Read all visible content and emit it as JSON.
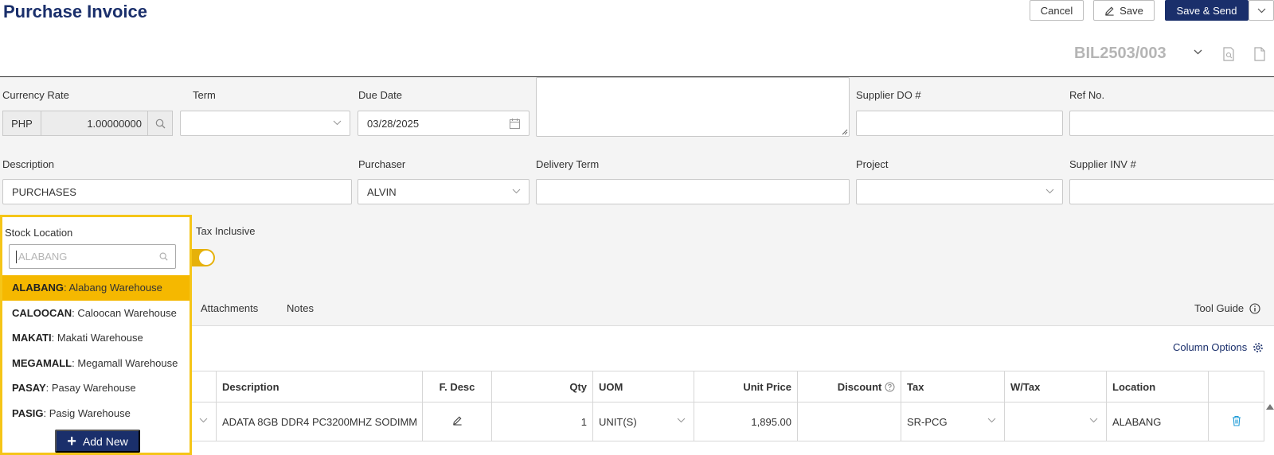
{
  "header": {
    "title": "Purchase Invoice",
    "cancel_label": "Cancel",
    "save_label": "Save",
    "save_send_label": "Save & Send",
    "doc_no": "BIL2503/003"
  },
  "form": {
    "currency_rate_label": "Currency Rate",
    "currency_code": "PHP",
    "currency_rate": "1.00000000",
    "term_label": "Term",
    "term_value": "",
    "due_date_label": "Due Date",
    "due_date_value": "03/28/2025",
    "supplier_do_label": "Supplier DO #",
    "ref_no_label": "Ref No.",
    "description_label": "Description",
    "description_value": "PURCHASES",
    "purchaser_label": "Purchaser",
    "purchaser_value": "ALVIN",
    "delivery_term_label": "Delivery Term",
    "project_label": "Project",
    "supplier_inv_label": "Supplier INV #",
    "stock_location_label": "Stock Location",
    "tax_inclusive_label": "Tax Inclusive",
    "tax_inclusive_on": true
  },
  "tabs": [
    "Attachments",
    "Notes"
  ],
  "tool_guide_label": "Tool Guide",
  "column_options_label": "Column Options",
  "grid": {
    "columns": [
      "Description",
      "F. Desc",
      "Qty",
      "UOM",
      "Unit Price",
      "Discount",
      "Tax",
      "W/Tax",
      "Location"
    ],
    "rows": [
      {
        "description": "ADATA 8GB DDR4 PC3200MHZ SODIMM",
        "qty": "1",
        "uom": "UNIT(S)",
        "unit_price": "1,895.00",
        "discount": "",
        "tax": "SR-PCG",
        "wtax": "",
        "location": "ALABANG"
      }
    ]
  },
  "dropdown": {
    "label": "Stock Location",
    "placeholder": "ALABANG",
    "items": [
      {
        "code": "ALABANG",
        "name": ": Alabang Warehouse",
        "active": true
      },
      {
        "code": "CALOOCAN",
        "name": ": Caloocan Warehouse",
        "active": false
      },
      {
        "code": "MAKATI",
        "name": ": Makati Warehouse",
        "active": false
      },
      {
        "code": "MEGAMALL",
        "name": ": Megamall Warehouse",
        "active": false
      },
      {
        "code": "PASAY",
        "name": ": Pasay Warehouse",
        "active": false
      },
      {
        "code": "PASIG",
        "name": ": Pasig Warehouse",
        "active": false
      }
    ],
    "add_new_label": "Add New"
  },
  "colors": {
    "brand": "#1a2f6b",
    "highlight": "#f5c518",
    "active_item": "#f5b800",
    "toggle": "#e6b10a"
  }
}
